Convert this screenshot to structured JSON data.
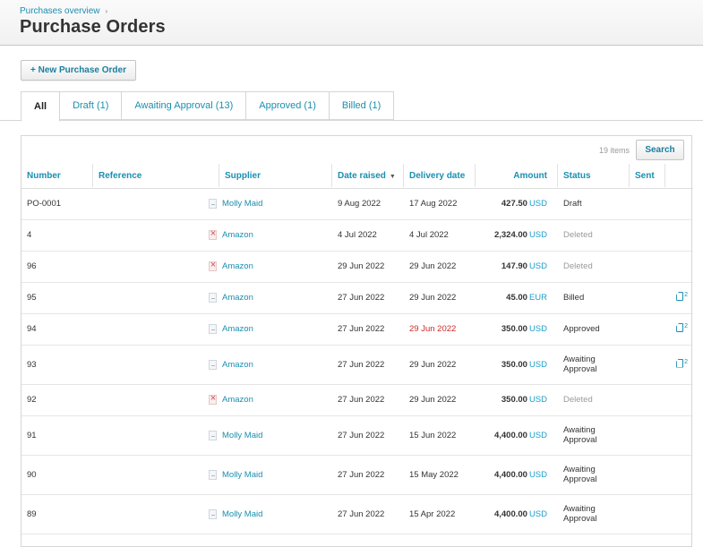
{
  "header": {
    "breadcrumb": "Purchases overview",
    "breadcrumb_sep": "›",
    "title": "Purchase Orders"
  },
  "actions": {
    "new_po_label": "+ New Purchase Order"
  },
  "tabs": [
    {
      "label": "All",
      "active": true
    },
    {
      "label": "Draft (1)",
      "active": false
    },
    {
      "label": "Awaiting Approval (13)",
      "active": false
    },
    {
      "label": "Approved (1)",
      "active": false
    },
    {
      "label": "Billed (1)",
      "active": false
    }
  ],
  "toolbar": {
    "items_count": "19 items",
    "search_label": "Search"
  },
  "table": {
    "columns": {
      "number": "Number",
      "reference": "Reference",
      "supplier": "Supplier",
      "date_raised": "Date raised",
      "date_raised_sort": "▼",
      "delivery_date": "Delivery date",
      "amount": "Amount",
      "status": "Status",
      "sent": "Sent"
    },
    "rows": [
      {
        "number": "PO-0001",
        "reference": "",
        "supplier": "Molly Maid",
        "icon": "document-icon",
        "date_raised": "9 Aug 2022",
        "delivery_date": "17 Aug 2022",
        "overdue": false,
        "amount": "427.50",
        "currency": "USD",
        "status": "Draft",
        "status_type": "normal",
        "sent": ""
      },
      {
        "number": "4",
        "reference": "",
        "supplier": "Amazon",
        "icon": "deleted-document-icon",
        "date_raised": "4 Jul 2022",
        "delivery_date": "4 Jul 2022",
        "overdue": false,
        "amount": "2,324.00",
        "currency": "USD",
        "status": "Deleted",
        "status_type": "deleted",
        "sent": ""
      },
      {
        "number": "96",
        "reference": "",
        "supplier": "Amazon",
        "icon": "deleted-document-icon",
        "date_raised": "29 Jun 2022",
        "delivery_date": "29 Jun 2022",
        "overdue": false,
        "amount": "147.90",
        "currency": "USD",
        "status": "Deleted",
        "status_type": "deleted",
        "sent": ""
      },
      {
        "number": "95",
        "reference": "",
        "supplier": "Amazon",
        "icon": "document-icon",
        "date_raised": "27 Jun 2022",
        "delivery_date": "29 Jun 2022",
        "overdue": false,
        "amount": "45.00",
        "currency": "EUR",
        "status": "Billed",
        "status_type": "normal",
        "sent": "2"
      },
      {
        "number": "94",
        "reference": "",
        "supplier": "Amazon",
        "icon": "document-icon",
        "date_raised": "27 Jun 2022",
        "delivery_date": "29 Jun 2022",
        "overdue": true,
        "amount": "350.00",
        "currency": "USD",
        "status": "Approved",
        "status_type": "normal",
        "sent": "2"
      },
      {
        "number": "93",
        "reference": "",
        "supplier": "Amazon",
        "icon": "document-icon",
        "date_raised": "27 Jun 2022",
        "delivery_date": "29 Jun 2022",
        "overdue": false,
        "amount": "350.00",
        "currency": "USD",
        "status": "Awaiting Approval",
        "status_type": "normal",
        "sent": "2"
      },
      {
        "number": "92",
        "reference": "",
        "supplier": "Amazon",
        "icon": "deleted-document-icon",
        "date_raised": "27 Jun 2022",
        "delivery_date": "29 Jun 2022",
        "overdue": false,
        "amount": "350.00",
        "currency": "USD",
        "status": "Deleted",
        "status_type": "deleted",
        "sent": ""
      },
      {
        "number": "91",
        "reference": "",
        "supplier": "Molly Maid",
        "icon": "document-icon",
        "date_raised": "27 Jun 2022",
        "delivery_date": "15 Jun 2022",
        "overdue": false,
        "amount": "4,400.00",
        "currency": "USD",
        "status": "Awaiting Approval",
        "status_type": "normal",
        "sent": ""
      },
      {
        "number": "90",
        "reference": "",
        "supplier": "Molly Maid",
        "icon": "document-icon",
        "date_raised": "27 Jun 2022",
        "delivery_date": "15 May 2022",
        "overdue": false,
        "amount": "4,400.00",
        "currency": "USD",
        "status": "Awaiting Approval",
        "status_type": "normal",
        "sent": ""
      },
      {
        "number": "89",
        "reference": "",
        "supplier": "Molly Maid",
        "icon": "document-icon",
        "date_raised": "27 Jun 2022",
        "delivery_date": "15 Apr 2022",
        "overdue": false,
        "amount": "4,400.00",
        "currency": "USD",
        "status": "Awaiting Approval",
        "status_type": "normal",
        "sent": ""
      }
    ]
  },
  "colors": {
    "link": "#1a8fb0",
    "currency": "#1a9fc9",
    "overdue": "#cc2a2a",
    "deleted": "#9a9a9a"
  }
}
